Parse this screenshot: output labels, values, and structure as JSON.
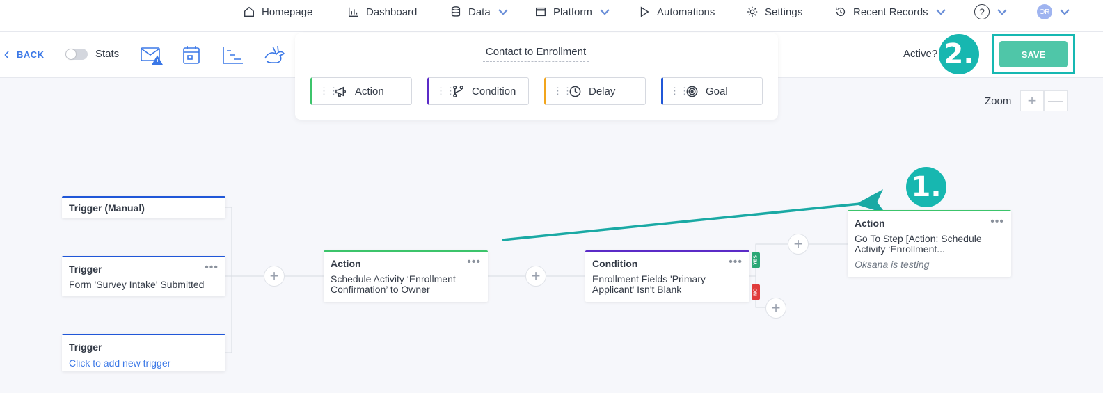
{
  "nav": {
    "homepage": "Homepage",
    "dashboard": "Dashboard",
    "data": "Data",
    "platform": "Platform",
    "automations": "Automations",
    "settings": "Settings",
    "recent_records": "Recent Records",
    "help": "?",
    "avatar_initials": "OR"
  },
  "toolbar": {
    "back_label": "BACK",
    "stats_label": "Stats",
    "stats_on": false,
    "active_label": "Active?",
    "save_label": "SAVE"
  },
  "annotations": {
    "step1": "1.",
    "step2": "2."
  },
  "palette": {
    "workflow_title": "Contact to Enrollment",
    "items": [
      {
        "label": "Action",
        "color": "#3cc46b"
      },
      {
        "label": "Condition",
        "color": "#5b2bc7"
      },
      {
        "label": "Delay",
        "color": "#f2a51c"
      },
      {
        "label": "Goal",
        "color": "#2057d8"
      }
    ]
  },
  "zoom": {
    "label": "Zoom",
    "plus": "+",
    "minus": "—"
  },
  "workflow": {
    "triggers": [
      {
        "title": "Trigger (Manual)",
        "body": ""
      },
      {
        "title": "Trigger",
        "body": "Form 'Survey Intake' Submitted"
      },
      {
        "title": "Trigger",
        "link": "Click to add new trigger"
      }
    ],
    "action1": {
      "title": "Action",
      "body": "Schedule Activity ‘Enrollment Confirmation’ to Owner"
    },
    "condition": {
      "title": "Condition",
      "body": "Enrollment Fields 'Primary Applicant' Isn't Blank",
      "yes": "YES",
      "no": "NO"
    },
    "action2": {
      "title": "Action",
      "body": "Go To Step [Action: Schedule Activity ‘Enrollment...",
      "note": "Oksana is testing"
    },
    "menu_dots": "•••",
    "plus": "+"
  },
  "colors": {
    "accent_blue": "#3b78e7",
    "save_green": "#4fc6a8",
    "annotation_teal": "#17b7b0",
    "action_border": "#3cc46b",
    "condition_border": "#5b2bc7",
    "trigger_border": "#2057d8"
  }
}
